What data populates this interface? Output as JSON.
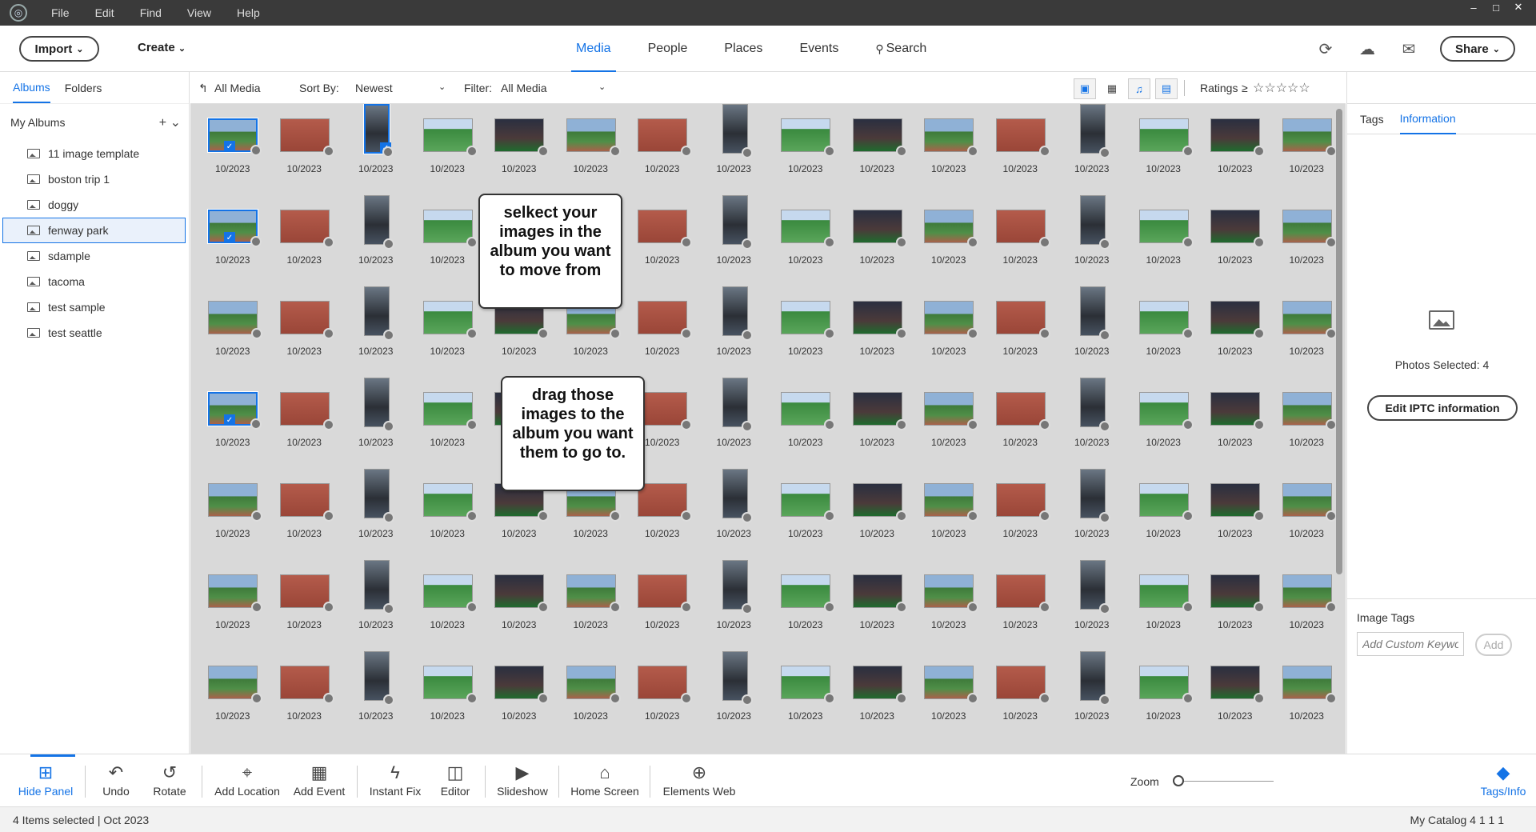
{
  "menu": [
    "File",
    "Edit",
    "Find",
    "View",
    "Help"
  ],
  "window_controls": [
    "–",
    "□",
    "✕"
  ],
  "toolbar": {
    "import_label": "Import",
    "create_label": "Create",
    "tabs": [
      "Media",
      "People",
      "Places",
      "Events",
      "Search"
    ],
    "active_tab": "Media",
    "share_label": "Share"
  },
  "left_panel": {
    "tabs": [
      "Albums",
      "Folders"
    ],
    "section_title": "My Albums",
    "albums": [
      "11 image template",
      "boston trip 1",
      "doggy",
      "fenway park",
      "sdample",
      "tacoma",
      "test sample",
      "test seattle"
    ],
    "selected_album": "fenway park"
  },
  "media_bar": {
    "all_media": "All Media",
    "sort_label": "Sort By:",
    "sort_value": "Newest",
    "filter_label": "Filter:",
    "filter_value": "All Media",
    "ratings_label": "Ratings",
    "ratings_op": "≥",
    "stars": "☆☆☆☆☆"
  },
  "grid": {
    "thumb_date": "10/2023",
    "columns": 16,
    "rows": 7,
    "selected_cells": [
      0,
      2,
      16,
      48
    ]
  },
  "callouts": {
    "first": "selkect your images in the album you want to move from",
    "second": "drag those images to the album you want them to go to."
  },
  "right_panel": {
    "tabs": [
      "Tags",
      "Information"
    ],
    "active_tab": "Information",
    "photos_selected": "Photos Selected: 4",
    "iptc_button": "Edit IPTC information",
    "image_tags_title": "Image Tags",
    "keyword_placeholder": "Add Custom Keywo",
    "add_label": "Add"
  },
  "bottom_toolbar": {
    "hide_panel": "Hide Panel",
    "undo": "Undo",
    "rotate": "Rotate",
    "add_location": "Add Location",
    "add_event": "Add Event",
    "instant_fix": "Instant Fix",
    "editor": "Editor",
    "slideshow": "Slideshow",
    "home_screen": "Home Screen",
    "elements_web": "Elements Web",
    "zoom": "Zoom",
    "tags_info": "Tags/Info"
  },
  "status": {
    "left": "4 Items selected | Oct 2023",
    "right": "My Catalog 4 1 1 1"
  },
  "colors": {
    "accent": "#1473e6",
    "grid_bg": "#d9d9d9",
    "titlebar": "#3a3a3a"
  }
}
